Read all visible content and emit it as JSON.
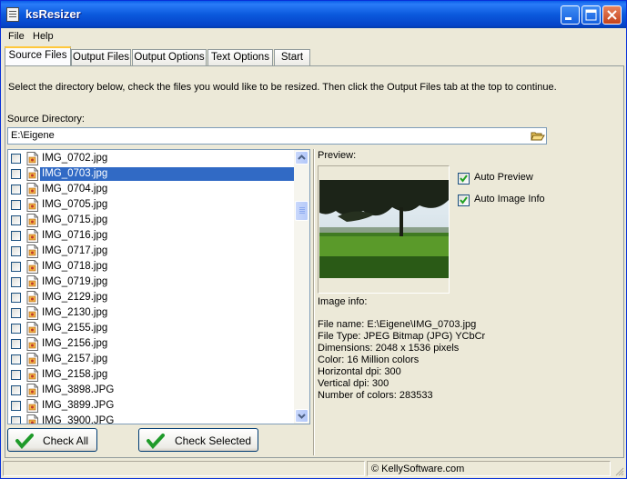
{
  "window": {
    "title": "ksResizer",
    "accent": "#0a5ee8"
  },
  "menu": [
    "File",
    "Help"
  ],
  "tabs": [
    {
      "label": "Source Files",
      "active": true
    },
    {
      "label": "Output Files"
    },
    {
      "label": "Output Options"
    },
    {
      "label": "Text Options"
    },
    {
      "label": "Start"
    }
  ],
  "instructions": "Select the directory below, check the files you would like to be resized. Then click the Output Files tab at the top to continue.",
  "source": {
    "label": "Source Directory:",
    "value": "E:\\Eigene",
    "browse_icon": "folder-open-icon"
  },
  "files": [
    {
      "name": "IMG_0702.jpg",
      "checked": false
    },
    {
      "name": "IMG_0703.jpg",
      "checked": false,
      "selected": true
    },
    {
      "name": "IMG_0704.jpg",
      "checked": false
    },
    {
      "name": "IMG_0705.jpg",
      "checked": false
    },
    {
      "name": "IMG_0715.jpg",
      "checked": false
    },
    {
      "name": "IMG_0716.jpg",
      "checked": false
    },
    {
      "name": "IMG_0717.jpg",
      "checked": false
    },
    {
      "name": "IMG_0718.jpg",
      "checked": false
    },
    {
      "name": "IMG_0719.jpg",
      "checked": false
    },
    {
      "name": "IMG_2129.jpg",
      "checked": false
    },
    {
      "name": "IMG_2130.jpg",
      "checked": false
    },
    {
      "name": "IMG_2155.jpg",
      "checked": false
    },
    {
      "name": "IMG_2156.jpg",
      "checked": false
    },
    {
      "name": "IMG_2157.jpg",
      "checked": false
    },
    {
      "name": "IMG_2158.jpg",
      "checked": false
    },
    {
      "name": "IMG_3898.JPG",
      "checked": false
    },
    {
      "name": "IMG_3899.JPG",
      "checked": false
    },
    {
      "name": "IMG_3900.JPG",
      "checked": false
    }
  ],
  "buttons": {
    "check_all": "Check All",
    "check_selected": "Check Selected"
  },
  "preview": {
    "label": "Preview:",
    "auto_preview": {
      "label": "Auto Preview",
      "checked": true
    },
    "auto_image_info": {
      "label": "Auto Image Info",
      "checked": true
    }
  },
  "image_info": {
    "label": "Image info:",
    "lines": [
      "File name: E:\\Eigene\\IMG_0703.jpg",
      "File Type: JPEG Bitmap (JPG) YCbCr",
      "Dimensions: 2048 x 1536 pixels",
      "Color: 16 Million colors",
      "Horizontal dpi: 300",
      "Vertical dpi: 300",
      "Number of colors: 283533"
    ]
  },
  "status": {
    "copyright": "© KellySoftware.com"
  }
}
